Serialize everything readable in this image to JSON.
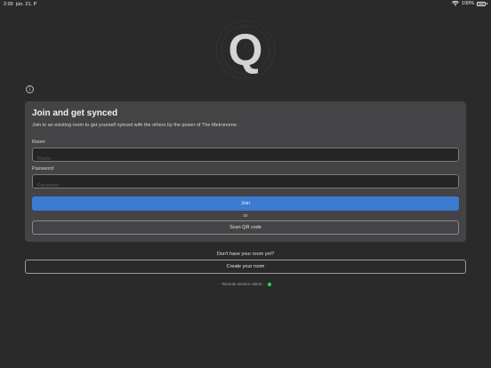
{
  "status_bar": {
    "time": "2:00",
    "date": "jún. 21. P",
    "battery_percent": "100%",
    "battery_level": 1.0
  },
  "logo": {
    "letter": "Q",
    "icon": "metronome-q-logo"
  },
  "info": {
    "icon": "info-icon"
  },
  "card": {
    "title": "Join and get synced",
    "description": "Join to an existing room to get yourself synced with the others by the power of The Metronome.",
    "room_label": "Room",
    "room_placeholder": "Room",
    "room_value": "",
    "password_label": "Password",
    "password_placeholder": "Password",
    "password_value": "",
    "join_label": "Join",
    "or_label": "or",
    "scan_label": "Scan QR code"
  },
  "footer": {
    "no_room_text": "Don't have your room yet?",
    "create_label": "Create your room",
    "service_text": "- Remote service online -",
    "service_status_color": "#2fd35a"
  },
  "colors": {
    "background": "#2a2a2b",
    "card": "#444446",
    "accent": "#3b7bd1"
  }
}
